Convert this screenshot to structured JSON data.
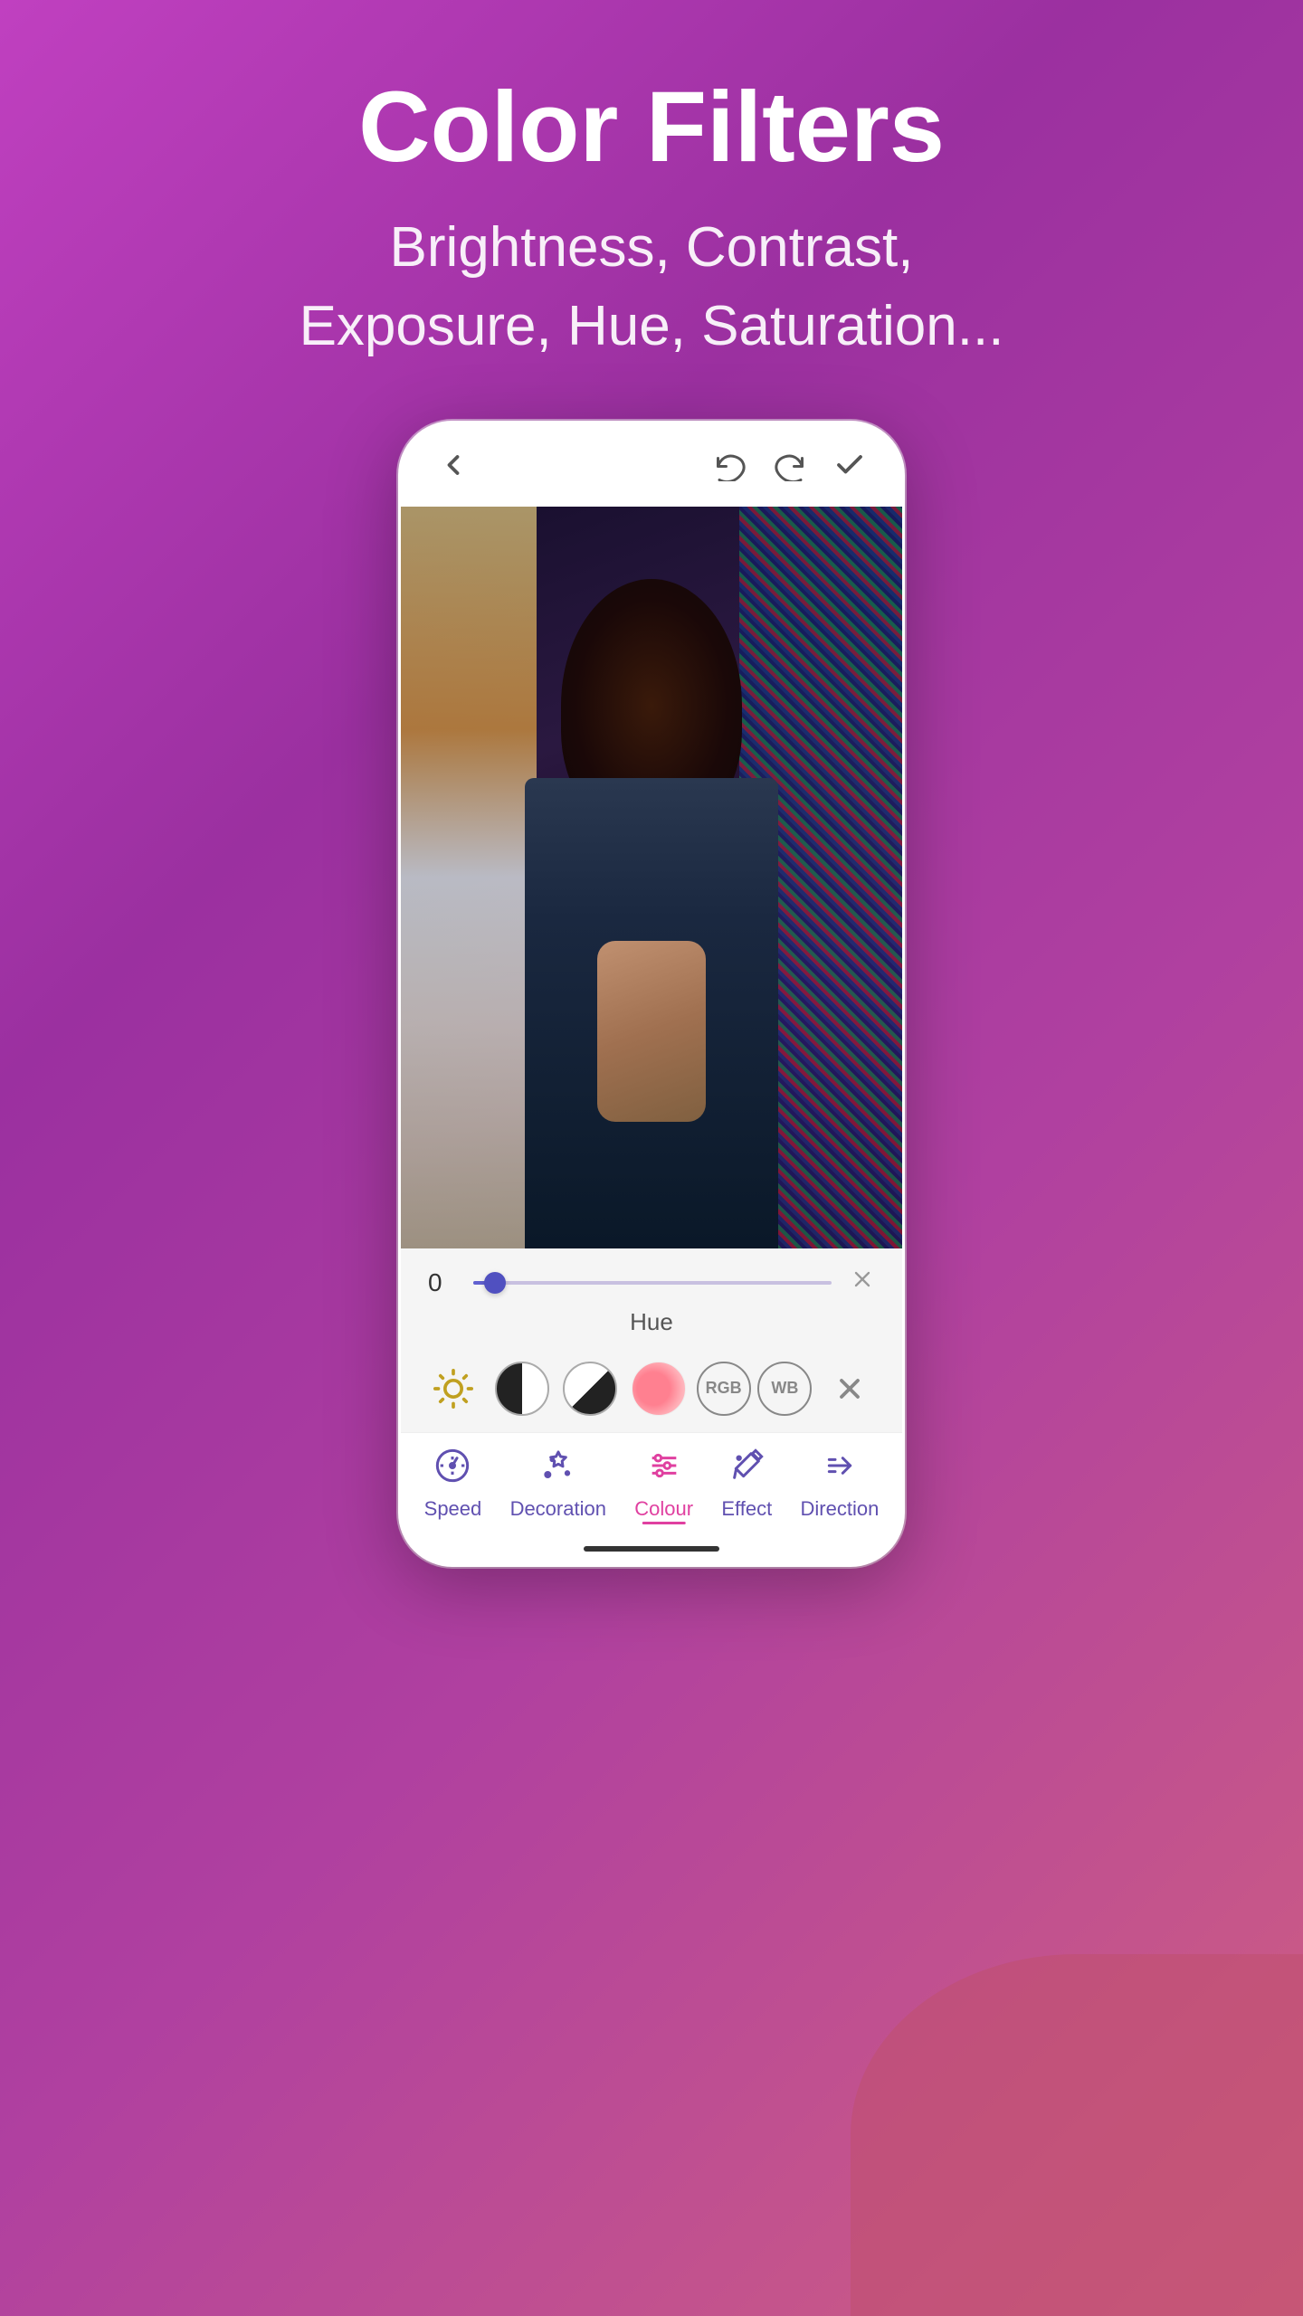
{
  "header": {
    "title": "Color Filters",
    "subtitle": "Brightness, Contrast,\nExposure, Hue, Saturation..."
  },
  "phone": {
    "topbar": {
      "back_label": "‹",
      "undo_label": "↺",
      "redo_label": "↻",
      "confirm_label": "✓"
    },
    "slider": {
      "value": "0",
      "label": "Hue"
    },
    "filter_icons": [
      {
        "name": "brightness",
        "type": "sun"
      },
      {
        "name": "contrast",
        "type": "halfmoon"
      },
      {
        "name": "exposure",
        "type": "halfcircle"
      },
      {
        "name": "hue",
        "type": "pink"
      },
      {
        "name": "rgb",
        "label": "RGB",
        "type": "circle"
      },
      {
        "name": "wb",
        "label": "WB",
        "type": "circle"
      },
      {
        "name": "close",
        "type": "x"
      }
    ],
    "nav": [
      {
        "id": "speed",
        "label": "Speed",
        "icon": "speedometer",
        "active": false
      },
      {
        "id": "decoration",
        "label": "Decoration",
        "icon": "sparkles",
        "active": false
      },
      {
        "id": "colour",
        "label": "Colour",
        "icon": "sliders",
        "active": true
      },
      {
        "id": "effect",
        "label": "Effect",
        "icon": "wand",
        "active": false
      },
      {
        "id": "direction",
        "label": "Direction",
        "icon": "arrows",
        "active": false
      }
    ]
  },
  "colors": {
    "background_gradient_start": "#c040c0",
    "background_gradient_end": "#d06080",
    "accent": "#e040a0",
    "nav_active": "#e040a0",
    "nav_inactive": "#6050b0",
    "slider_color": "#6060d0",
    "title_color": "#ffffff"
  }
}
